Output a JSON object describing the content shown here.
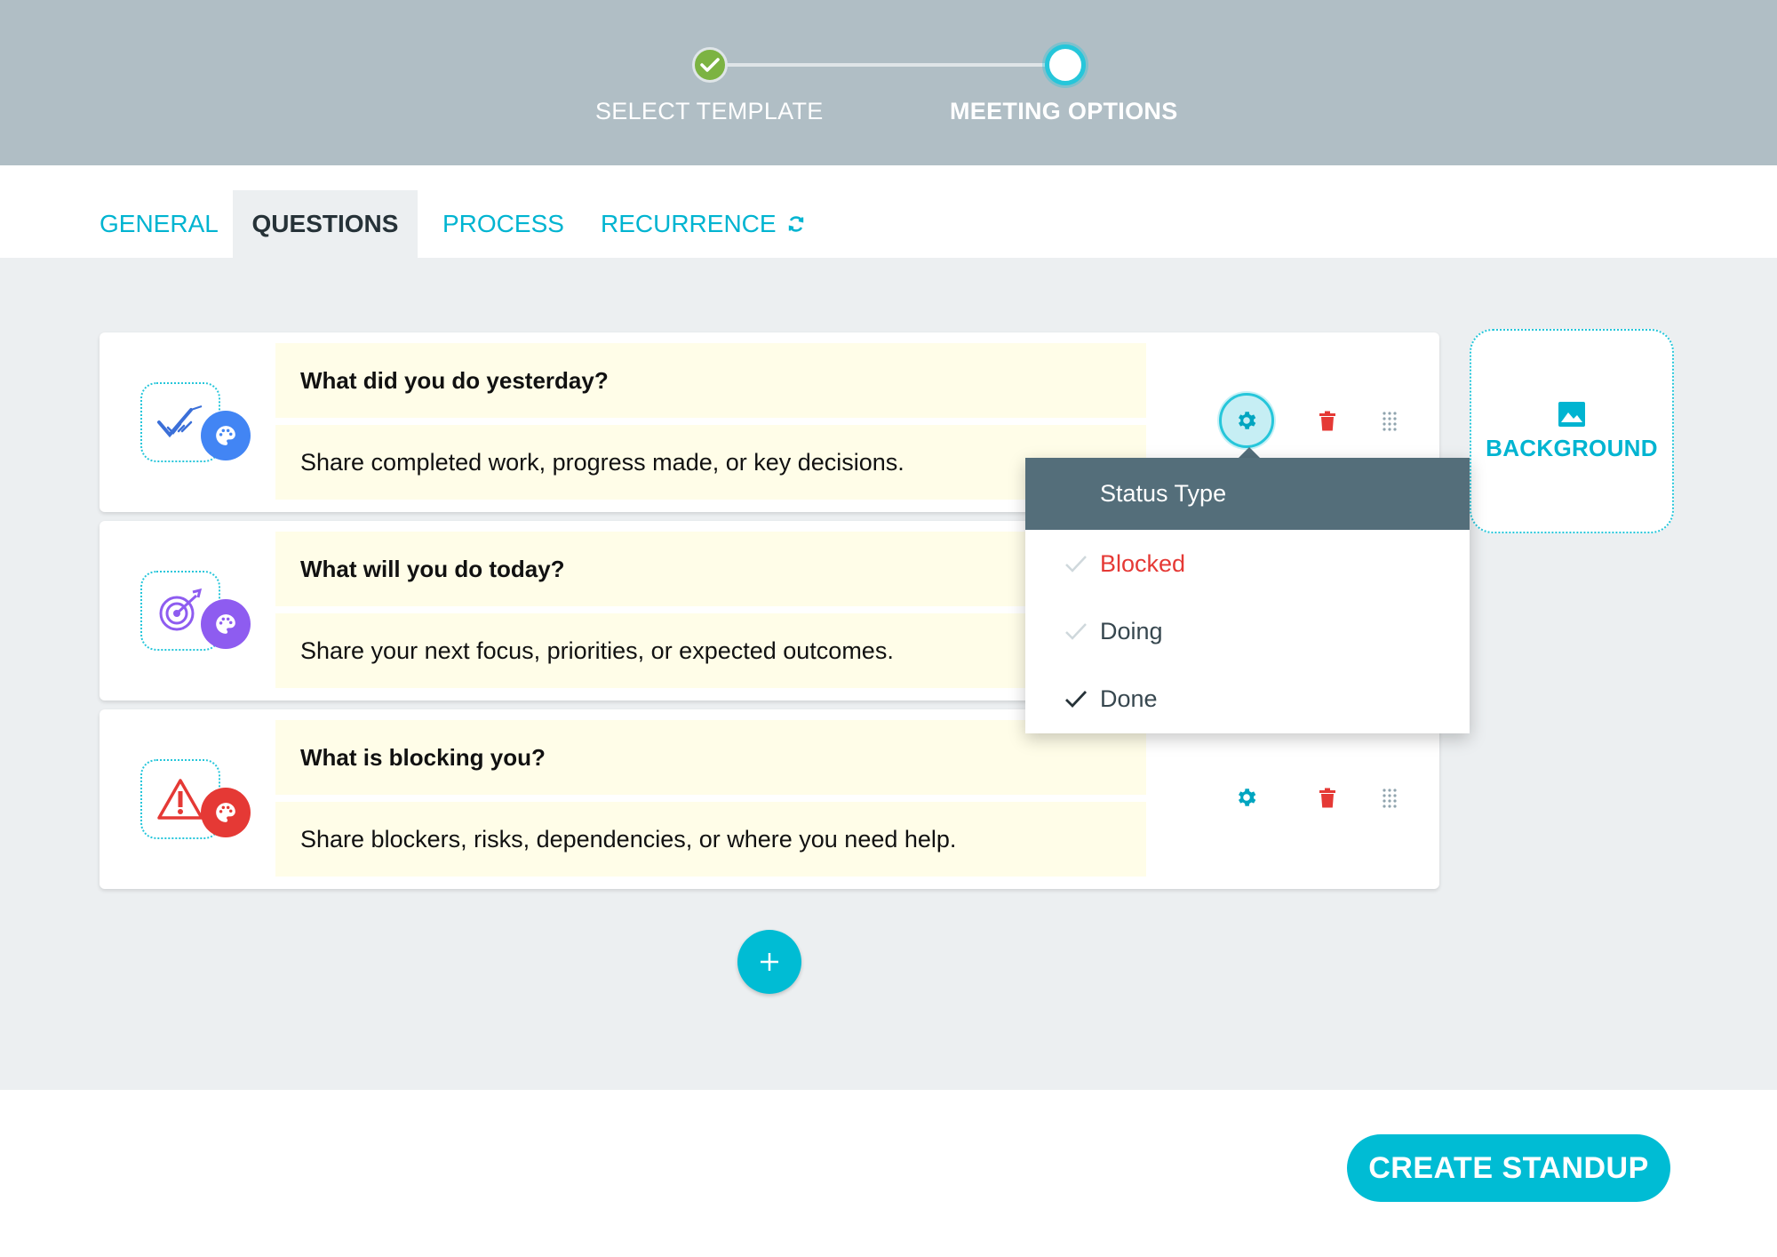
{
  "stepper": {
    "steps": [
      {
        "label": "SELECT TEMPLATE",
        "state": "completed"
      },
      {
        "label": "MEETING OPTIONS",
        "state": "current"
      }
    ]
  },
  "tabs": [
    {
      "label": "GENERAL",
      "active": false
    },
    {
      "label": "QUESTIONS",
      "active": true
    },
    {
      "label": "PROCESS",
      "active": false
    },
    {
      "label": "RECURRENCE",
      "active": false,
      "icon": "refresh-icon"
    }
  ],
  "questions": [
    {
      "title": "What did you do yesterday?",
      "description": "Share completed work, progress made, or key decisions.",
      "icon": "check-marks-icon",
      "palette_color": "#4285f4",
      "settings_open": true
    },
    {
      "title": "What will you do today?",
      "description": "Share your next focus, priorities, or expected outcomes.",
      "icon": "target-icon",
      "palette_color": "#8e5cf0",
      "settings_open": false
    },
    {
      "title": "What is blocking you?",
      "description": "Share blockers, risks, dependencies, or where you need help.",
      "icon": "warning-icon",
      "palette_color": "#e53935",
      "settings_open": false
    }
  ],
  "background_button": {
    "label": "BACKGROUND",
    "icon": "image-icon"
  },
  "status_dropdown": {
    "header": "Status Type",
    "options": [
      {
        "label": "Blocked",
        "checked": false,
        "color": "#e53935"
      },
      {
        "label": "Doing",
        "checked": false,
        "color": "#37474f"
      },
      {
        "label": "Done",
        "checked": true,
        "color": "#37474f"
      }
    ]
  },
  "add_button": {
    "icon": "plus-icon"
  },
  "footer": {
    "create_label": "CREATE STANDUP"
  },
  "colors": {
    "accent": "#00bcd4",
    "header_bg": "#b0bec5",
    "step_done": "#7cb342",
    "danger": "#e53935",
    "question_bg": "#fffde8"
  }
}
